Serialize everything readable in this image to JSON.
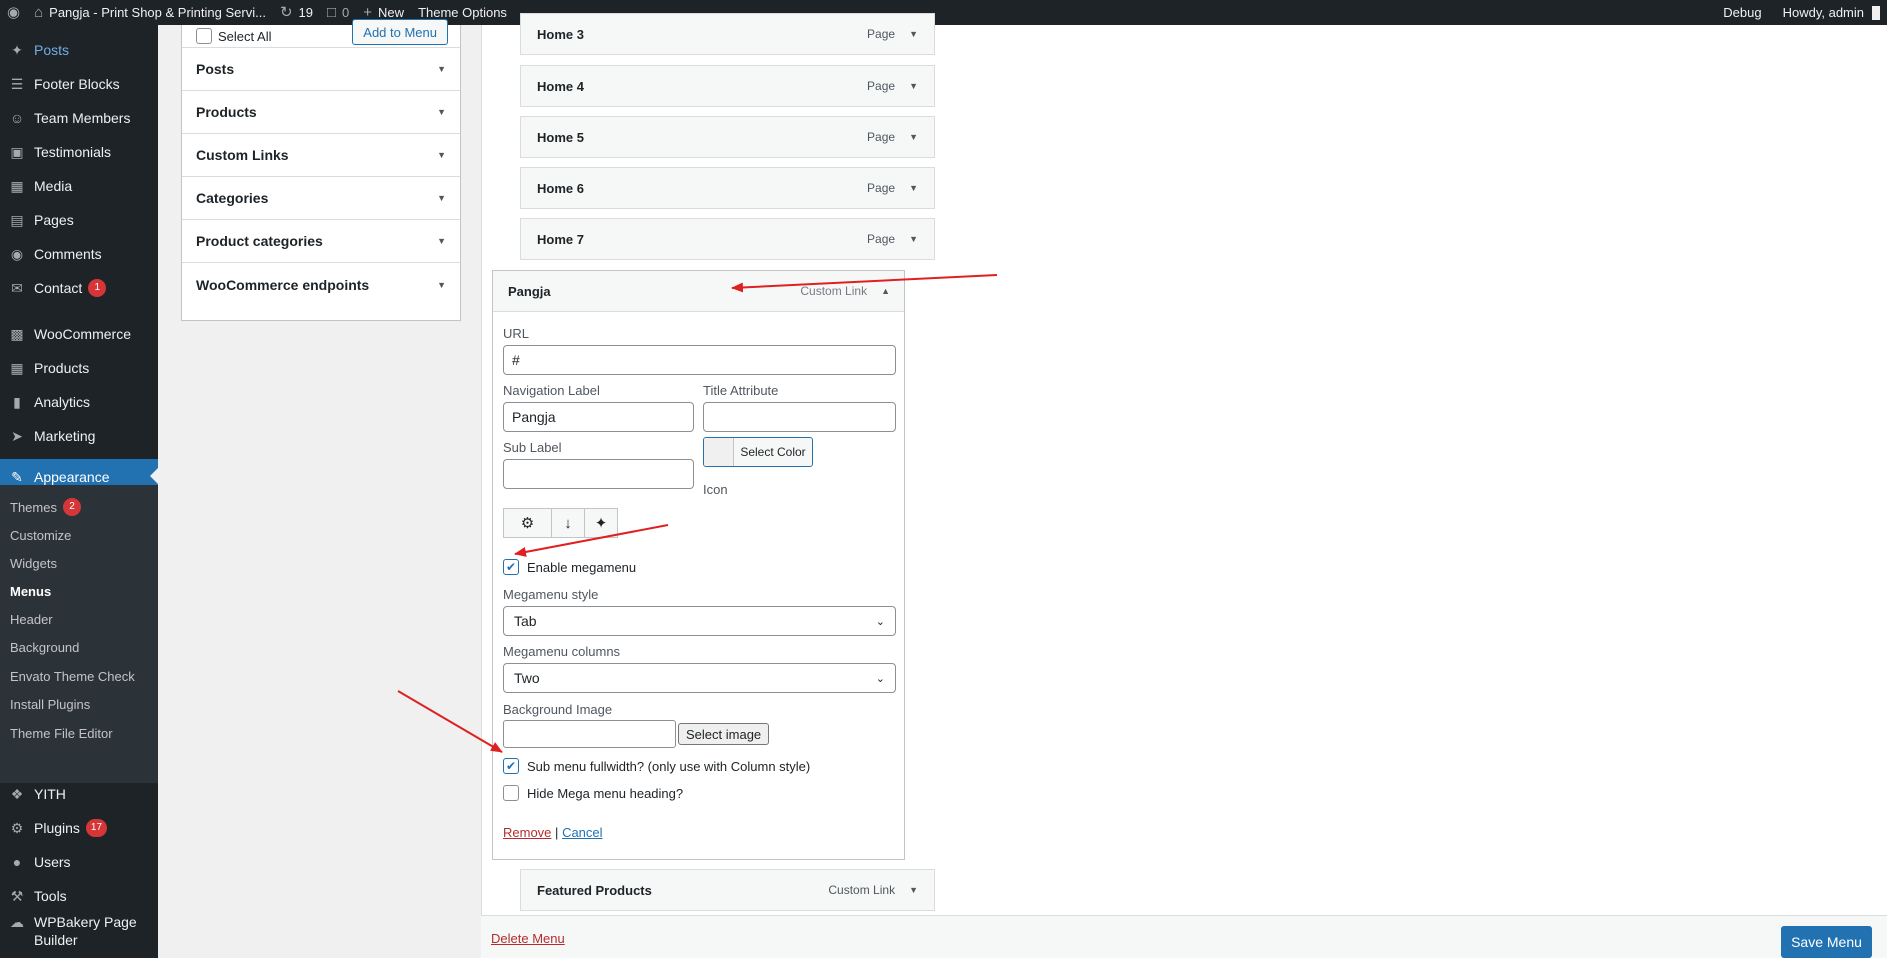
{
  "adminbar": {
    "site_title": "Pangja - Print Shop & Printing Servi...",
    "updates_count": "19",
    "comments_count": "0",
    "new_label": "New",
    "theme_options_label": "Theme Options",
    "debug_label": "Debug",
    "howdy_label": "Howdy, admin"
  },
  "sidebar": {
    "items": [
      {
        "label": "Posts",
        "icon": "pin-icon"
      },
      {
        "label": "Footer Blocks",
        "icon": "list-icon"
      },
      {
        "label": "Team Members",
        "icon": "team-icon"
      },
      {
        "label": "Testimonials",
        "icon": "testimonial-icon"
      },
      {
        "label": "Media",
        "icon": "media-icon"
      },
      {
        "label": "Pages",
        "icon": "pages-icon"
      },
      {
        "label": "Comments",
        "icon": "comments-icon"
      },
      {
        "label": "Contact",
        "icon": "mail-icon",
        "badge": "1"
      },
      {
        "label": "WooCommerce",
        "icon": "woo-icon"
      },
      {
        "label": "Products",
        "icon": "products-icon"
      },
      {
        "label": "Analytics",
        "icon": "analytics-icon"
      },
      {
        "label": "Marketing",
        "icon": "megaphone-icon"
      },
      {
        "label": "Appearance",
        "icon": "brush-icon"
      }
    ],
    "submenu": [
      {
        "label": "Themes",
        "badge": "2"
      },
      {
        "label": "Customize"
      },
      {
        "label": "Widgets"
      },
      {
        "label": "Menus"
      },
      {
        "label": "Header"
      },
      {
        "label": "Background"
      },
      {
        "label": "Envato Theme Check"
      },
      {
        "label": "Install Plugins"
      },
      {
        "label": "Theme File Editor"
      }
    ],
    "lower_items": [
      {
        "label": "YITH",
        "icon": "yith-icon"
      },
      {
        "label": "Plugins",
        "icon": "plugins-icon",
        "badge": "17"
      },
      {
        "label": "Users",
        "icon": "users-icon"
      },
      {
        "label": "Tools",
        "icon": "tools-icon"
      },
      {
        "label": "WPBakery Page Builder",
        "icon": "wpbakery-icon"
      }
    ]
  },
  "accordion": {
    "select_all": "Select All",
    "add_to_menu": "Add to Menu",
    "sections": [
      "Posts",
      "Products",
      "Custom Links",
      "Categories",
      "Product categories",
      "WooCommerce endpoints"
    ]
  },
  "menu_items": [
    {
      "title": "Home 3",
      "type": "Page"
    },
    {
      "title": "Home 4",
      "type": "Page"
    },
    {
      "title": "Home 5",
      "type": "Page"
    },
    {
      "title": "Home 6",
      "type": "Page"
    },
    {
      "title": "Home 7",
      "type": "Page"
    }
  ],
  "custom_item": {
    "title": "Pangja",
    "type": "Custom Link",
    "url_label": "URL",
    "url_value": "#",
    "nav_label_label": "Navigation Label",
    "nav_label_value": "Pangja",
    "title_attr_label": "Title Attribute",
    "sub_label_label": "Sub Label",
    "select_color": "Select Color",
    "icon_label": "Icon",
    "enable_megamenu": "Enable megamenu",
    "megamenu_style_label": "Megamenu style",
    "megamenu_style_value": "Tab",
    "megamenu_columns_label": "Megamenu columns",
    "megamenu_columns_value": "Two",
    "background_image_label": "Background Image",
    "select_image": "Select image",
    "sub_menu_fullwidth": "Sub menu fullwidth? (only use with Column style)",
    "hide_heading": "Hide Mega menu heading?",
    "remove": "Remove",
    "separator": "|",
    "cancel": "Cancel"
  },
  "featured_item": {
    "title": "Featured Products",
    "type": "Custom Link"
  },
  "footer": {
    "delete_menu": "Delete Menu",
    "save_menu": "Save Menu"
  },
  "colors": {
    "accent": "#2271b1",
    "annotation_arrow": "#e02020",
    "admin_dark": "#1d2327"
  }
}
